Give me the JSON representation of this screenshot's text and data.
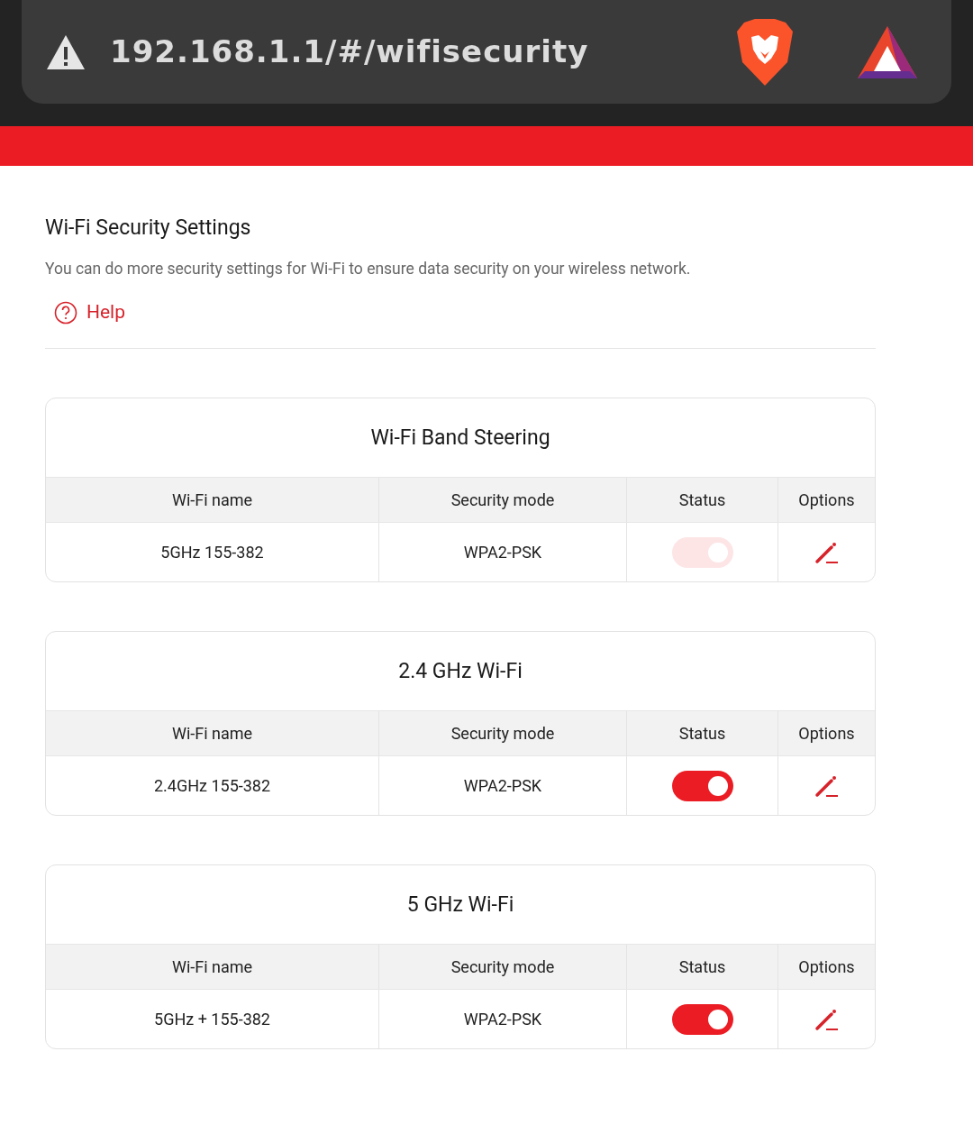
{
  "browser": {
    "url": "192.168.1.1/#/wifisecurity"
  },
  "page": {
    "title": "Wi-Fi Security Settings",
    "description": "You can do more security settings for Wi-Fi to ensure data security on your wireless network.",
    "help": "Help"
  },
  "cards": [
    {
      "title": "Wi-Fi Band Steering",
      "columns": [
        "Wi-Fi name",
        "Security mode",
        "Status",
        "Options"
      ],
      "row": {
        "name": "5GHz 155-382",
        "security": "WPA2-PSK",
        "on": true,
        "disabled": true
      }
    },
    {
      "title": "2.4 GHz Wi-Fi",
      "columns": [
        "Wi-Fi name",
        "Security mode",
        "Status",
        "Options"
      ],
      "row": {
        "name": "2.4GHz 155-382",
        "security": "WPA2-PSK",
        "on": true,
        "disabled": false
      }
    },
    {
      "title": "5 GHz Wi-Fi",
      "columns": [
        "Wi-Fi name",
        "Security mode",
        "Status",
        "Options"
      ],
      "row": {
        "name": "5GHz + 155-382",
        "security": "WPA2-PSK",
        "on": true,
        "disabled": false
      }
    }
  ]
}
